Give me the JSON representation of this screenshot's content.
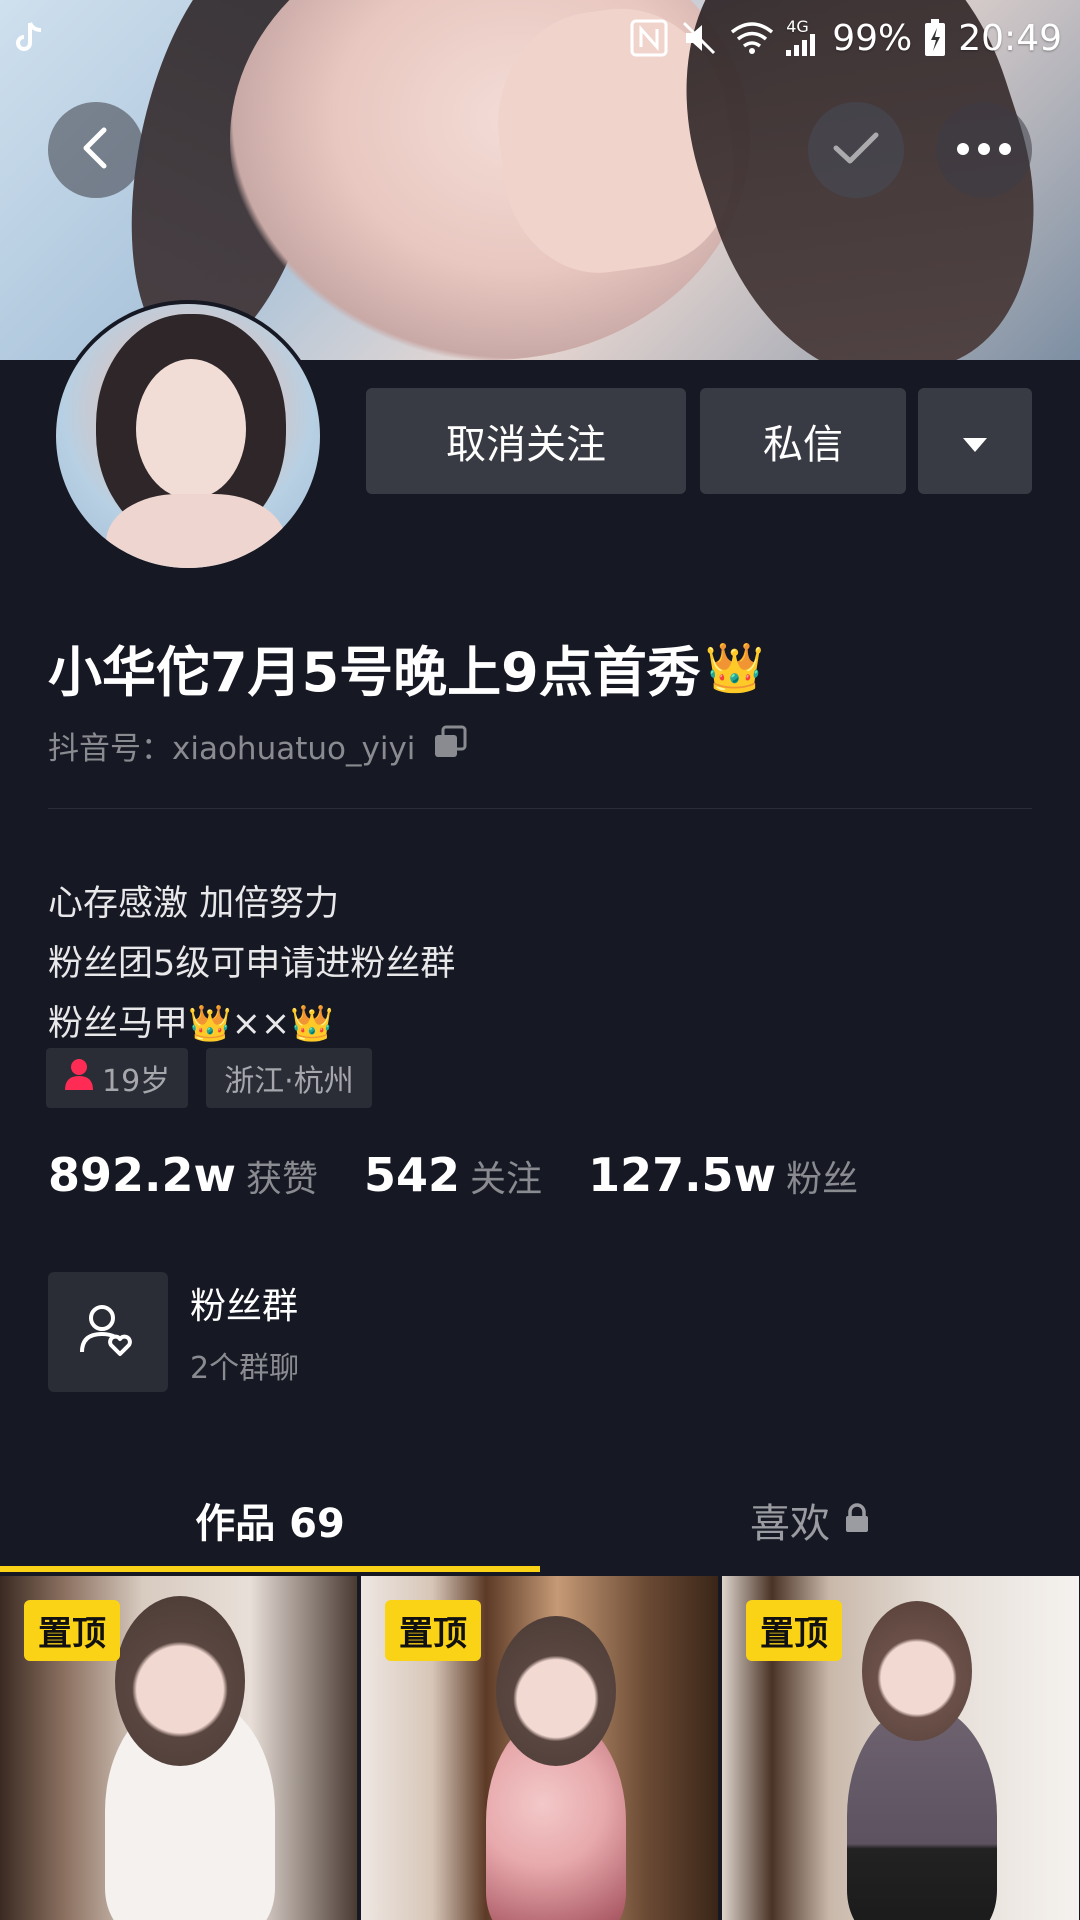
{
  "status_bar": {
    "app_icon": "tiktok-note-icon",
    "network": "4G",
    "battery": "99%",
    "time": "20:49"
  },
  "profile": {
    "name": "小华佗7月5号晚上9点首秀",
    "name_emoji": "👑",
    "douyin_id": "抖音号：xiaohuatuo_yiyi",
    "buttons": {
      "unfollow": "取消关注",
      "message": "私信"
    },
    "bio": [
      "心存感激 加倍努力",
      "粉丝团5级可申请进粉丝群",
      "粉丝马甲👑××👑"
    ],
    "tags": {
      "age": "19岁",
      "location": "浙江·杭州"
    },
    "stats": [
      {
        "value": "892.2w",
        "label": "获赞"
      },
      {
        "value": "542",
        "label": "关注"
      },
      {
        "value": "127.5w",
        "label": "粉丝"
      }
    ],
    "fan_group": {
      "title": "粉丝群",
      "subtitle": "2个群聊"
    }
  },
  "tabs": [
    {
      "label": "作品 69",
      "active": true
    },
    {
      "label": "喜欢",
      "active": false,
      "locked": true
    }
  ],
  "videos": [
    {
      "badge": "置顶"
    },
    {
      "badge": "置顶"
    },
    {
      "badge": "置顶"
    }
  ],
  "colors": {
    "background": "#161823",
    "button": "#393b44",
    "accent": "#fbd316",
    "tag_gender": "#fe2c55"
  }
}
